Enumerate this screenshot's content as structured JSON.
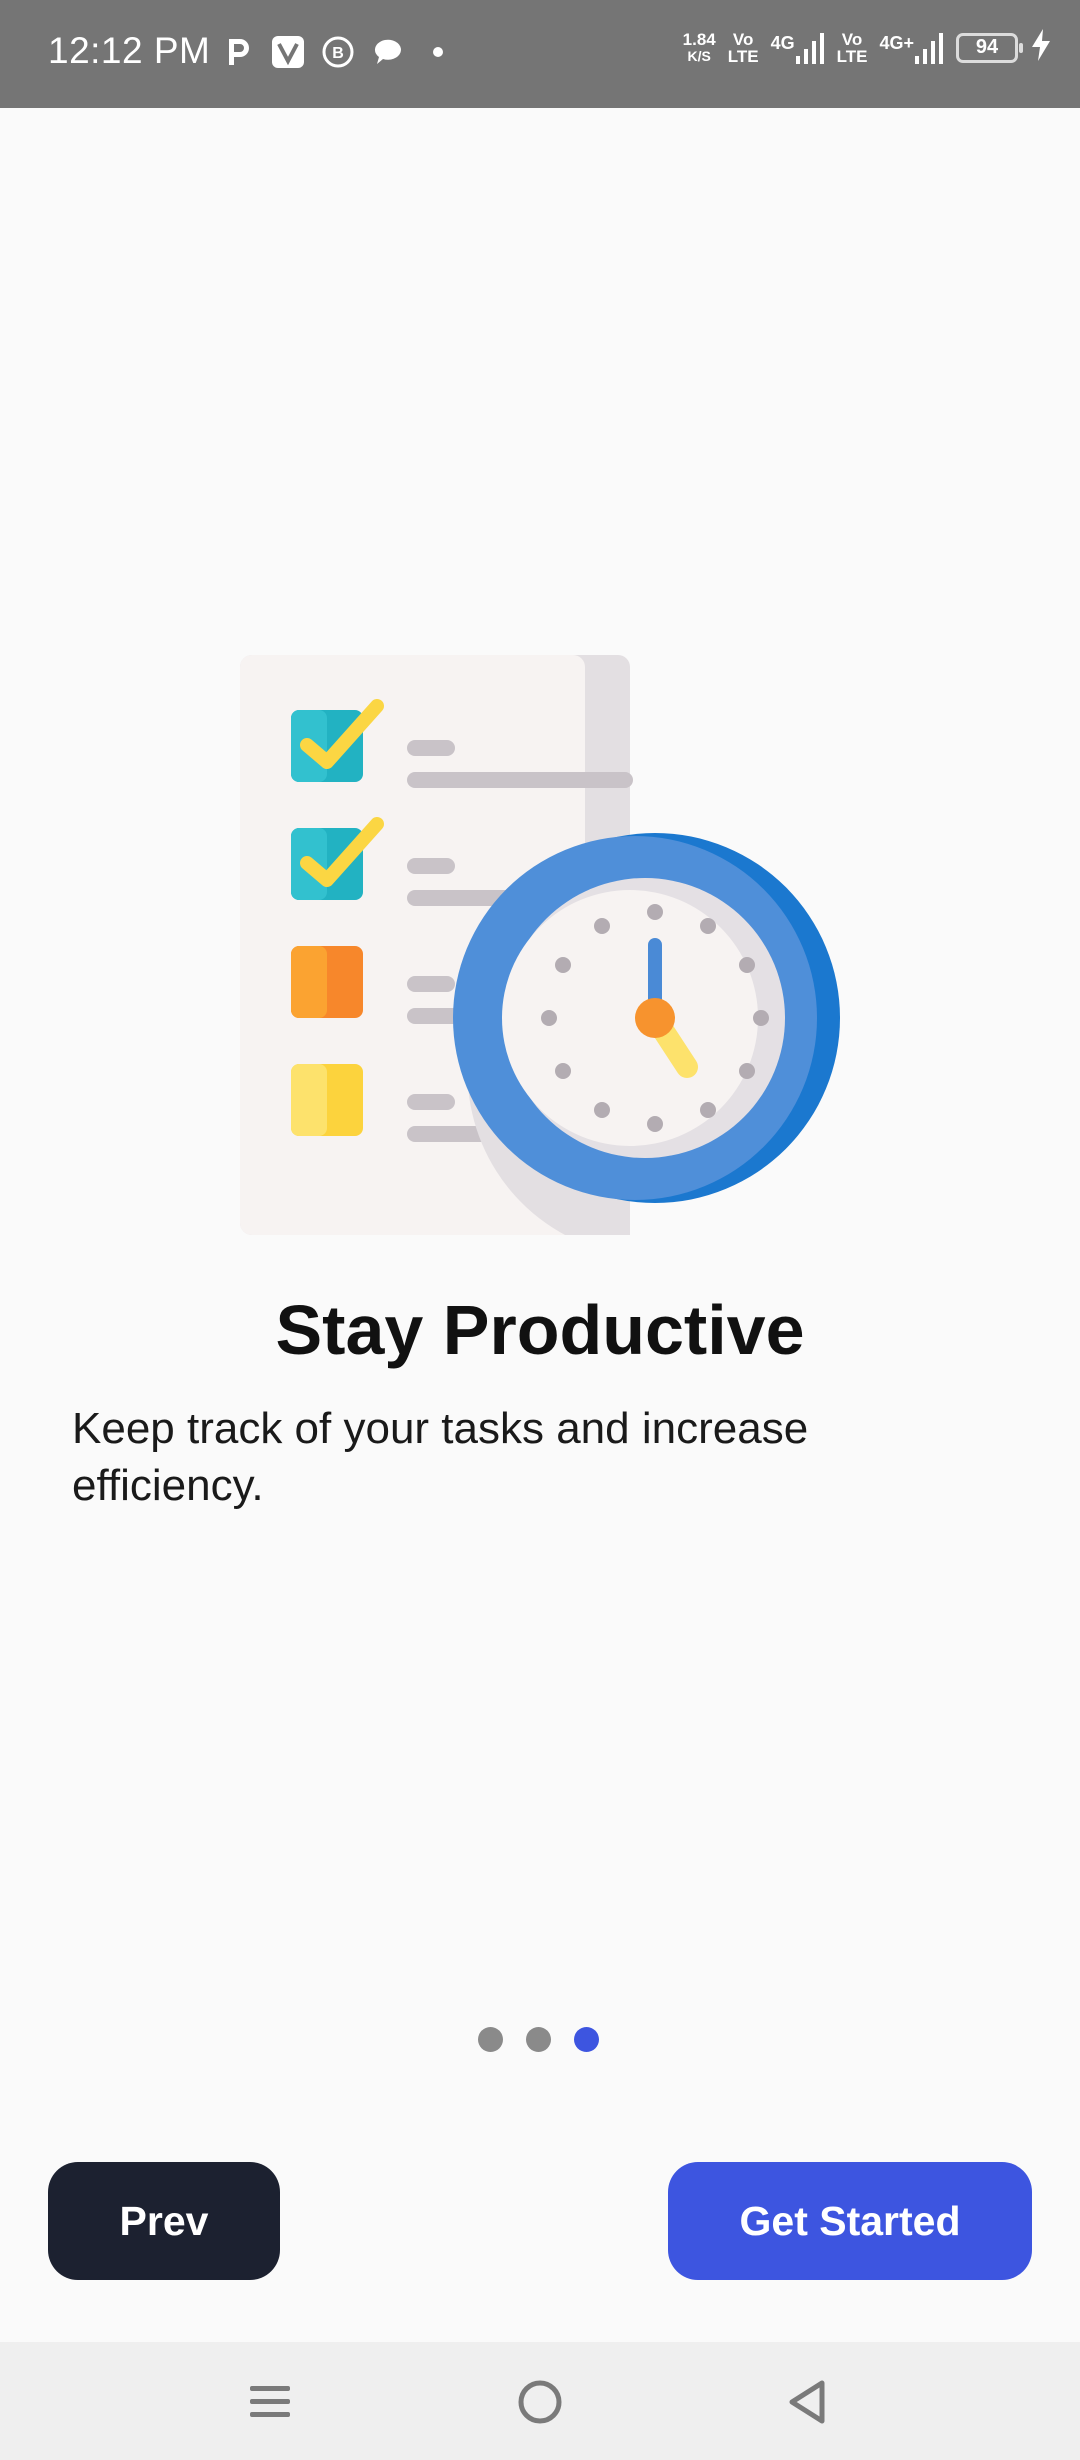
{
  "status_bar": {
    "time": "12:12 PM",
    "notification_icons": [
      "parking-icon",
      "v-app-icon",
      "b-app-icon",
      "chat-bubble-icon",
      "dot-icon"
    ],
    "net_speed_value": "1.84",
    "net_speed_unit": "K/S",
    "volte_1_top": "Vo",
    "volte_1_bottom": "LTE",
    "network_1": "4G",
    "volte_2_top": "Vo",
    "volte_2_bottom": "LTE",
    "network_2": "4G+",
    "battery_level": "94"
  },
  "onboarding": {
    "title": "Stay Productive",
    "description": "Keep track of your tasks and increase efficiency.",
    "pages_total": 3,
    "current_page": 3
  },
  "buttons": {
    "prev_label": "Prev",
    "next_label": "Get Started"
  },
  "colors": {
    "accent": "#3d55e0",
    "dark_button": "#1c2130",
    "status_bar": "#757575",
    "background": "#fafafa"
  },
  "nav_bar": {
    "icons": [
      "menu-icon",
      "home-icon",
      "back-icon"
    ]
  }
}
